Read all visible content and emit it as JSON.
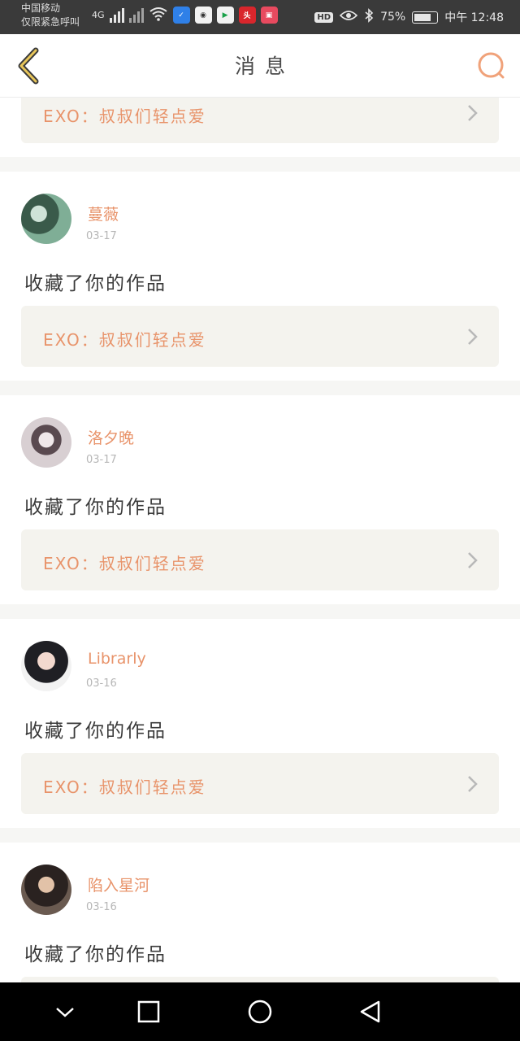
{
  "status_bar": {
    "carrier_line1": "中国移动",
    "carrier_line2": "仅限紧急呼叫",
    "network": "4G",
    "battery": "75%",
    "battery_level": 0.75,
    "time": "中午 12:48",
    "app_icons": [
      "shield-app",
      "game-app",
      "video-app",
      "news-app",
      "gift-app"
    ]
  },
  "header": {
    "title": "消息",
    "back_icon": "back-chevron-icon",
    "search_icon": "search-icon"
  },
  "accent_color": "#e8936a",
  "notifications": [
    {
      "user": "",
      "date": "",
      "message": "",
      "work_title": "EXO：叔叔们轻点爱"
    },
    {
      "user": "蔓薇",
      "date": "03-17",
      "message": "收藏了你的作品",
      "work_title": "EXO：叔叔们轻点爱"
    },
    {
      "user": "洛夕晚",
      "date": "03-17",
      "message": "收藏了你的作品",
      "work_title": "EXO：叔叔们轻点爱"
    },
    {
      "user": "Librarly",
      "date": "03-16",
      "message": "收藏了你的作品",
      "work_title": "EXO：叔叔们轻点爱"
    },
    {
      "user": "陷入星河",
      "date": "03-16",
      "message": "收藏了你的作品",
      "work_title": ""
    }
  ],
  "nav": {
    "icons": [
      "hide-keyboard-icon",
      "recents-icon",
      "home-icon",
      "back-icon"
    ]
  }
}
